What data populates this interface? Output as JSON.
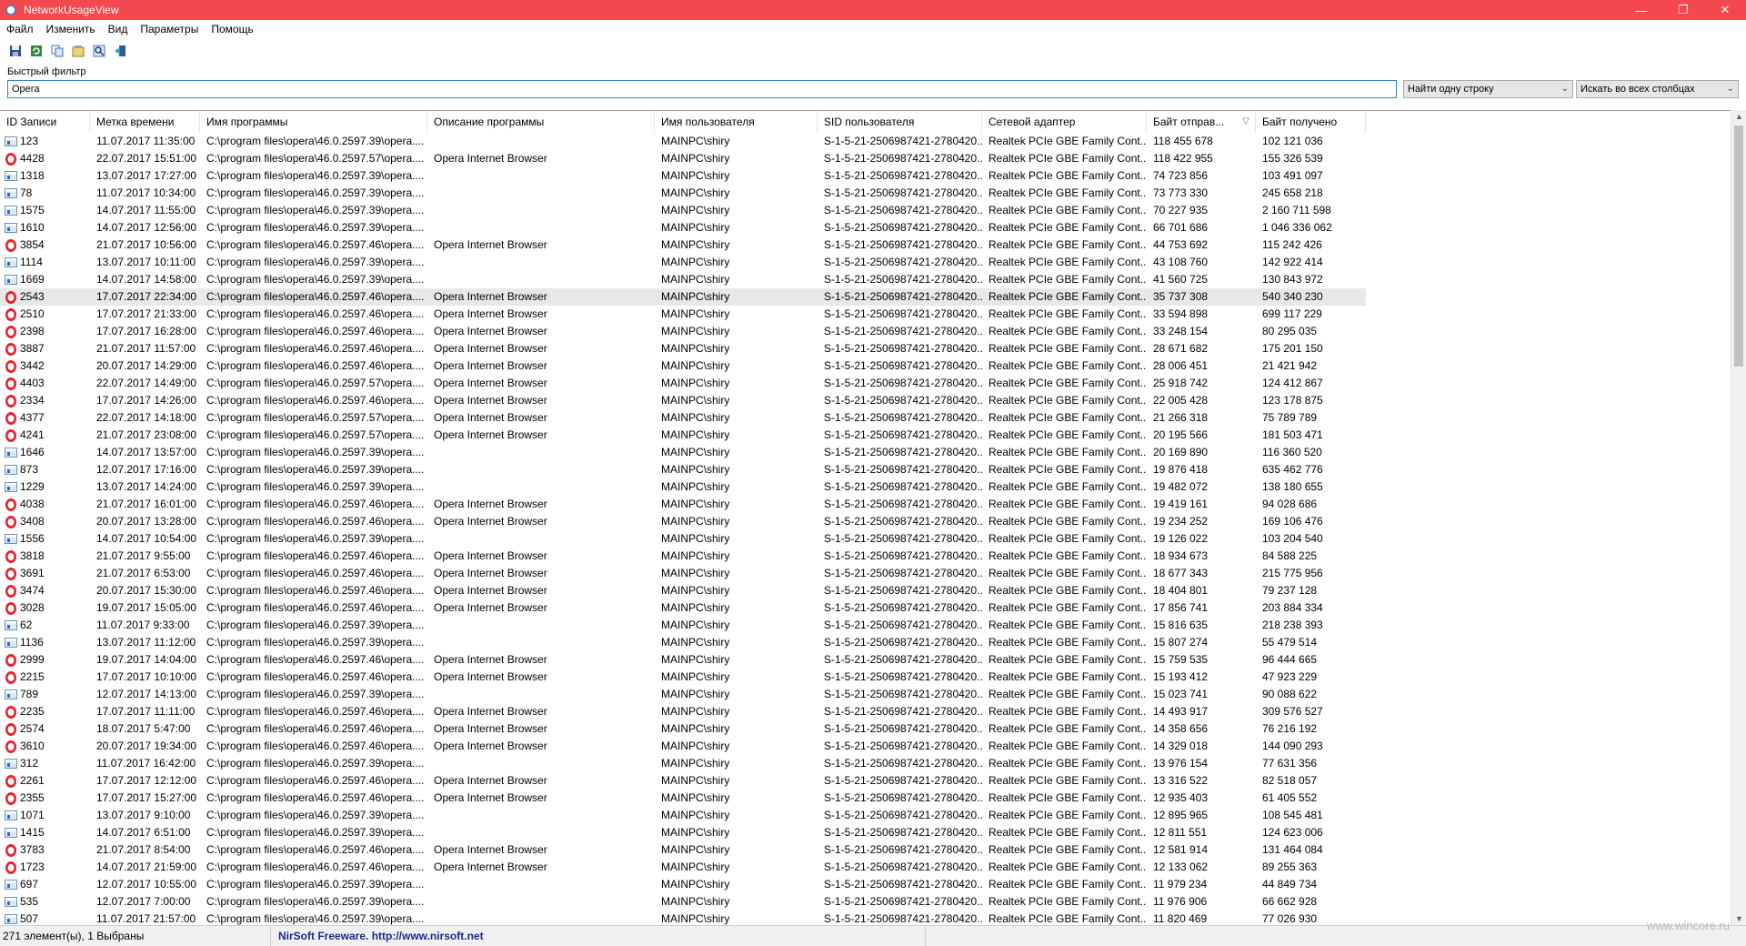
{
  "window": {
    "title": "NetworkUsageView",
    "minimize": "—",
    "maximize": "❐",
    "close": "✕"
  },
  "menu": [
    "Файл",
    "Изменить",
    "Вид",
    "Параметры",
    "Помощь"
  ],
  "toolbar": [
    "save-icon",
    "refresh-icon",
    "copy-icon",
    "properties-icon",
    "find-icon",
    "exit-icon"
  ],
  "filter": {
    "label": "Быстрый фильтр",
    "value": "Opera",
    "mode": "Найти одну строку",
    "scope": "Искать во всех столбцах"
  },
  "columns": [
    "ID Записи",
    "Метка времени",
    "Имя программы",
    "Описание программы",
    "Имя пользователя",
    "SID пользователя",
    "Сетевой адаптер",
    "Байт отправ...",
    "Байт получено"
  ],
  "rows": [
    {
      "icon": "app",
      "id": "123",
      "time": "11.07.2017 11:35:00",
      "prog": "C:\\program files\\opera\\46.0.2597.39\\opera....",
      "desc": "",
      "user": "MAINPC\\shiry",
      "sid": "S-1-5-21-2506987421-2780420...",
      "adapter": "Realtek PCIe GBE Family Cont...",
      "sent": "118 455 678",
      "recv": "102 121 036"
    },
    {
      "icon": "opera",
      "id": "4428",
      "time": "22.07.2017 15:51:00",
      "prog": "C:\\program files\\opera\\46.0.2597.57\\opera....",
      "desc": "Opera Internet Browser",
      "user": "MAINPC\\shiry",
      "sid": "S-1-5-21-2506987421-2780420...",
      "adapter": "Realtek PCIe GBE Family Cont...",
      "sent": "118 422 955",
      "recv": "155 326 539"
    },
    {
      "icon": "app",
      "id": "1318",
      "time": "13.07.2017 17:27:00",
      "prog": "C:\\program files\\opera\\46.0.2597.39\\opera....",
      "desc": "",
      "user": "MAINPC\\shiry",
      "sid": "S-1-5-21-2506987421-2780420...",
      "adapter": "Realtek PCIe GBE Family Cont...",
      "sent": "74 723 856",
      "recv": "103 491 097"
    },
    {
      "icon": "app",
      "id": "78",
      "time": "11.07.2017 10:34:00",
      "prog": "C:\\program files\\opera\\46.0.2597.39\\opera....",
      "desc": "",
      "user": "MAINPC\\shiry",
      "sid": "S-1-5-21-2506987421-2780420...",
      "adapter": "Realtek PCIe GBE Family Cont...",
      "sent": "73 773 330",
      "recv": "245 658 218"
    },
    {
      "icon": "app",
      "id": "1575",
      "time": "14.07.2017 11:55:00",
      "prog": "C:\\program files\\opera\\46.0.2597.39\\opera....",
      "desc": "",
      "user": "MAINPC\\shiry",
      "sid": "S-1-5-21-2506987421-2780420...",
      "adapter": "Realtek PCIe GBE Family Cont...",
      "sent": "70 227 935",
      "recv": "2 160 711 598"
    },
    {
      "icon": "app",
      "id": "1610",
      "time": "14.07.2017 12:56:00",
      "prog": "C:\\program files\\opera\\46.0.2597.39\\opera....",
      "desc": "",
      "user": "MAINPC\\shiry",
      "sid": "S-1-5-21-2506987421-2780420...",
      "adapter": "Realtek PCIe GBE Family Cont...",
      "sent": "66 701 686",
      "recv": "1 046 336 062"
    },
    {
      "icon": "opera",
      "id": "3854",
      "time": "21.07.2017 10:56:00",
      "prog": "C:\\program files\\opera\\46.0.2597.46\\opera....",
      "desc": "Opera Internet Browser",
      "user": "MAINPC\\shiry",
      "sid": "S-1-5-21-2506987421-2780420...",
      "adapter": "Realtek PCIe GBE Family Cont...",
      "sent": "44 753 692",
      "recv": "115 242 426"
    },
    {
      "icon": "app",
      "id": "1114",
      "time": "13.07.2017 10:11:00",
      "prog": "C:\\program files\\opera\\46.0.2597.39\\opera....",
      "desc": "",
      "user": "MAINPC\\shiry",
      "sid": "S-1-5-21-2506987421-2780420...",
      "adapter": "Realtek PCIe GBE Family Cont...",
      "sent": "43 108 760",
      "recv": "142 922 414"
    },
    {
      "icon": "app",
      "id": "1669",
      "time": "14.07.2017 14:58:00",
      "prog": "C:\\program files\\opera\\46.0.2597.39\\opera....",
      "desc": "",
      "user": "MAINPC\\shiry",
      "sid": "S-1-5-21-2506987421-2780420...",
      "adapter": "Realtek PCIe GBE Family Cont...",
      "sent": "41 560 725",
      "recv": "130 843 972"
    },
    {
      "icon": "opera",
      "id": "2543",
      "time": "17.07.2017 22:34:00",
      "prog": "C:\\program files\\opera\\46.0.2597.46\\opera....",
      "desc": "Opera Internet Browser",
      "user": "MAINPC\\shiry",
      "sid": "S-1-5-21-2506987421-2780420...",
      "adapter": "Realtek PCIe GBE Family Cont...",
      "sent": "35 737 308",
      "recv": "540 340 230",
      "selected": true
    },
    {
      "icon": "opera",
      "id": "2510",
      "time": "17.07.2017 21:33:00",
      "prog": "C:\\program files\\opera\\46.0.2597.46\\opera....",
      "desc": "Opera Internet Browser",
      "user": "MAINPC\\shiry",
      "sid": "S-1-5-21-2506987421-2780420...",
      "adapter": "Realtek PCIe GBE Family Cont...",
      "sent": "33 594 898",
      "recv": "699 117 229"
    },
    {
      "icon": "opera",
      "id": "2398",
      "time": "17.07.2017 16:28:00",
      "prog": "C:\\program files\\opera\\46.0.2597.46\\opera....",
      "desc": "Opera Internet Browser",
      "user": "MAINPC\\shiry",
      "sid": "S-1-5-21-2506987421-2780420...",
      "adapter": "Realtek PCIe GBE Family Cont...",
      "sent": "33 248 154",
      "recv": "80 295 035"
    },
    {
      "icon": "opera",
      "id": "3887",
      "time": "21.07.2017 11:57:00",
      "prog": "C:\\program files\\opera\\46.0.2597.46\\opera....",
      "desc": "Opera Internet Browser",
      "user": "MAINPC\\shiry",
      "sid": "S-1-5-21-2506987421-2780420...",
      "adapter": "Realtek PCIe GBE Family Cont...",
      "sent": "28 671 682",
      "recv": "175 201 150"
    },
    {
      "icon": "opera",
      "id": "3442",
      "time": "20.07.2017 14:29:00",
      "prog": "C:\\program files\\opera\\46.0.2597.46\\opera....",
      "desc": "Opera Internet Browser",
      "user": "MAINPC\\shiry",
      "sid": "S-1-5-21-2506987421-2780420...",
      "adapter": "Realtek PCIe GBE Family Cont...",
      "sent": "28 006 451",
      "recv": "21 421 942"
    },
    {
      "icon": "opera",
      "id": "4403",
      "time": "22.07.2017 14:49:00",
      "prog": "C:\\program files\\opera\\46.0.2597.57\\opera....",
      "desc": "Opera Internet Browser",
      "user": "MAINPC\\shiry",
      "sid": "S-1-5-21-2506987421-2780420...",
      "adapter": "Realtek PCIe GBE Family Cont...",
      "sent": "25 918 742",
      "recv": "124 412 867"
    },
    {
      "icon": "opera",
      "id": "2334",
      "time": "17.07.2017 14:26:00",
      "prog": "C:\\program files\\opera\\46.0.2597.46\\opera....",
      "desc": "Opera Internet Browser",
      "user": "MAINPC\\shiry",
      "sid": "S-1-5-21-2506987421-2780420...",
      "adapter": "Realtek PCIe GBE Family Cont...",
      "sent": "22 005 428",
      "recv": "123 178 875"
    },
    {
      "icon": "opera",
      "id": "4377",
      "time": "22.07.2017 14:18:00",
      "prog": "C:\\program files\\opera\\46.0.2597.57\\opera....",
      "desc": "Opera Internet Browser",
      "user": "MAINPC\\shiry",
      "sid": "S-1-5-21-2506987421-2780420...",
      "adapter": "Realtek PCIe GBE Family Cont...",
      "sent": "21 266 318",
      "recv": "75 789 789"
    },
    {
      "icon": "opera",
      "id": "4241",
      "time": "21.07.2017 23:08:00",
      "prog": "C:\\program files\\opera\\46.0.2597.57\\opera....",
      "desc": "Opera Internet Browser",
      "user": "MAINPC\\shiry",
      "sid": "S-1-5-21-2506987421-2780420...",
      "adapter": "Realtek PCIe GBE Family Cont...",
      "sent": "20 195 566",
      "recv": "181 503 471"
    },
    {
      "icon": "app",
      "id": "1646",
      "time": "14.07.2017 13:57:00",
      "prog": "C:\\program files\\opera\\46.0.2597.39\\opera....",
      "desc": "",
      "user": "MAINPC\\shiry",
      "sid": "S-1-5-21-2506987421-2780420...",
      "adapter": "Realtek PCIe GBE Family Cont...",
      "sent": "20 169 890",
      "recv": "116 360 520"
    },
    {
      "icon": "app",
      "id": "873",
      "time": "12.07.2017 17:16:00",
      "prog": "C:\\program files\\opera\\46.0.2597.39\\opera....",
      "desc": "",
      "user": "MAINPC\\shiry",
      "sid": "S-1-5-21-2506987421-2780420...",
      "adapter": "Realtek PCIe GBE Family Cont...",
      "sent": "19 876 418",
      "recv": "635 462 776"
    },
    {
      "icon": "app",
      "id": "1229",
      "time": "13.07.2017 14:24:00",
      "prog": "C:\\program files\\opera\\46.0.2597.39\\opera....",
      "desc": "",
      "user": "MAINPC\\shiry",
      "sid": "S-1-5-21-2506987421-2780420...",
      "adapter": "Realtek PCIe GBE Family Cont...",
      "sent": "19 482 072",
      "recv": "138 180 655"
    },
    {
      "icon": "opera",
      "id": "4038",
      "time": "21.07.2017 16:01:00",
      "prog": "C:\\program files\\opera\\46.0.2597.46\\opera....",
      "desc": "Opera Internet Browser",
      "user": "MAINPC\\shiry",
      "sid": "S-1-5-21-2506987421-2780420...",
      "adapter": "Realtek PCIe GBE Family Cont...",
      "sent": "19 419 161",
      "recv": "94 028 686"
    },
    {
      "icon": "opera",
      "id": "3408",
      "time": "20.07.2017 13:28:00",
      "prog": "C:\\program files\\opera\\46.0.2597.46\\opera....",
      "desc": "Opera Internet Browser",
      "user": "MAINPC\\shiry",
      "sid": "S-1-5-21-2506987421-2780420...",
      "adapter": "Realtek PCIe GBE Family Cont...",
      "sent": "19 234 252",
      "recv": "169 106 476"
    },
    {
      "icon": "app",
      "id": "1556",
      "time": "14.07.2017 10:54:00",
      "prog": "C:\\program files\\opera\\46.0.2597.39\\opera....",
      "desc": "",
      "user": "MAINPC\\shiry",
      "sid": "S-1-5-21-2506987421-2780420...",
      "adapter": "Realtek PCIe GBE Family Cont...",
      "sent": "19 126 022",
      "recv": "103 204 540"
    },
    {
      "icon": "opera",
      "id": "3818",
      "time": "21.07.2017 9:55:00",
      "prog": "C:\\program files\\opera\\46.0.2597.46\\opera....",
      "desc": "Opera Internet Browser",
      "user": "MAINPC\\shiry",
      "sid": "S-1-5-21-2506987421-2780420...",
      "adapter": "Realtek PCIe GBE Family Cont...",
      "sent": "18 934 673",
      "recv": "84 588 225"
    },
    {
      "icon": "opera",
      "id": "3691",
      "time": "21.07.2017 6:53:00",
      "prog": "C:\\program files\\opera\\46.0.2597.46\\opera....",
      "desc": "Opera Internet Browser",
      "user": "MAINPC\\shiry",
      "sid": "S-1-5-21-2506987421-2780420...",
      "adapter": "Realtek PCIe GBE Family Cont...",
      "sent": "18 677 343",
      "recv": "215 775 956"
    },
    {
      "icon": "opera",
      "id": "3474",
      "time": "20.07.2017 15:30:00",
      "prog": "C:\\program files\\opera\\46.0.2597.46\\opera....",
      "desc": "Opera Internet Browser",
      "user": "MAINPC\\shiry",
      "sid": "S-1-5-21-2506987421-2780420...",
      "adapter": "Realtek PCIe GBE Family Cont...",
      "sent": "18 404 801",
      "recv": "79 237 128"
    },
    {
      "icon": "opera",
      "id": "3028",
      "time": "19.07.2017 15:05:00",
      "prog": "C:\\program files\\opera\\46.0.2597.46\\opera....",
      "desc": "Opera Internet Browser",
      "user": "MAINPC\\shiry",
      "sid": "S-1-5-21-2506987421-2780420...",
      "adapter": "Realtek PCIe GBE Family Cont...",
      "sent": "17 856 741",
      "recv": "203 884 334"
    },
    {
      "icon": "app",
      "id": "62",
      "time": "11.07.2017 9:33:00",
      "prog": "C:\\program files\\opera\\46.0.2597.39\\opera....",
      "desc": "",
      "user": "MAINPC\\shiry",
      "sid": "S-1-5-21-2506987421-2780420...",
      "adapter": "Realtek PCIe GBE Family Cont...",
      "sent": "15 816 635",
      "recv": "218 238 393"
    },
    {
      "icon": "app",
      "id": "1136",
      "time": "13.07.2017 11:12:00",
      "prog": "C:\\program files\\opera\\46.0.2597.39\\opera....",
      "desc": "",
      "user": "MAINPC\\shiry",
      "sid": "S-1-5-21-2506987421-2780420...",
      "adapter": "Realtek PCIe GBE Family Cont...",
      "sent": "15 807 274",
      "recv": "55 479 514"
    },
    {
      "icon": "opera",
      "id": "2999",
      "time": "19.07.2017 14:04:00",
      "prog": "C:\\program files\\opera\\46.0.2597.46\\opera....",
      "desc": "Opera Internet Browser",
      "user": "MAINPC\\shiry",
      "sid": "S-1-5-21-2506987421-2780420...",
      "adapter": "Realtek PCIe GBE Family Cont...",
      "sent": "15 759 535",
      "recv": "96 444 665"
    },
    {
      "icon": "opera",
      "id": "2215",
      "time": "17.07.2017 10:10:00",
      "prog": "C:\\program files\\opera\\46.0.2597.46\\opera....",
      "desc": "Opera Internet Browser",
      "user": "MAINPC\\shiry",
      "sid": "S-1-5-21-2506987421-2780420...",
      "adapter": "Realtek PCIe GBE Family Cont...",
      "sent": "15 193 412",
      "recv": "47 923 229"
    },
    {
      "icon": "app",
      "id": "789",
      "time": "12.07.2017 14:13:00",
      "prog": "C:\\program files\\opera\\46.0.2597.39\\opera....",
      "desc": "",
      "user": "MAINPC\\shiry",
      "sid": "S-1-5-21-2506987421-2780420...",
      "adapter": "Realtek PCIe GBE Family Cont...",
      "sent": "15 023 741",
      "recv": "90 088 622"
    },
    {
      "icon": "opera",
      "id": "2235",
      "time": "17.07.2017 11:11:00",
      "prog": "C:\\program files\\opera\\46.0.2597.46\\opera....",
      "desc": "Opera Internet Browser",
      "user": "MAINPC\\shiry",
      "sid": "S-1-5-21-2506987421-2780420...",
      "adapter": "Realtek PCIe GBE Family Cont...",
      "sent": "14 493 917",
      "recv": "309 576 527"
    },
    {
      "icon": "opera",
      "id": "2574",
      "time": "18.07.2017 5:47:00",
      "prog": "C:\\program files\\opera\\46.0.2597.46\\opera....",
      "desc": "Opera Internet Browser",
      "user": "MAINPC\\shiry",
      "sid": "S-1-5-21-2506987421-2780420...",
      "adapter": "Realtek PCIe GBE Family Cont...",
      "sent": "14 358 656",
      "recv": "76 216 192"
    },
    {
      "icon": "opera",
      "id": "3610",
      "time": "20.07.2017 19:34:00",
      "prog": "C:\\program files\\opera\\46.0.2597.46\\opera....",
      "desc": "Opera Internet Browser",
      "user": "MAINPC\\shiry",
      "sid": "S-1-5-21-2506987421-2780420...",
      "adapter": "Realtek PCIe GBE Family Cont...",
      "sent": "14 329 018",
      "recv": "144 090 293"
    },
    {
      "icon": "app",
      "id": "312",
      "time": "11.07.2017 16:42:00",
      "prog": "C:\\program files\\opera\\46.0.2597.39\\opera....",
      "desc": "",
      "user": "MAINPC\\shiry",
      "sid": "S-1-5-21-2506987421-2780420...",
      "adapter": "Realtek PCIe GBE Family Cont...",
      "sent": "13 976 154",
      "recv": "77 631 356"
    },
    {
      "icon": "opera",
      "id": "2261",
      "time": "17.07.2017 12:12:00",
      "prog": "C:\\program files\\opera\\46.0.2597.46\\opera....",
      "desc": "Opera Internet Browser",
      "user": "MAINPC\\shiry",
      "sid": "S-1-5-21-2506987421-2780420...",
      "adapter": "Realtek PCIe GBE Family Cont...",
      "sent": "13 316 522",
      "recv": "82 518 057"
    },
    {
      "icon": "opera",
      "id": "2355",
      "time": "17.07.2017 15:27:00",
      "prog": "C:\\program files\\opera\\46.0.2597.46\\opera....",
      "desc": "Opera Internet Browser",
      "user": "MAINPC\\shiry",
      "sid": "S-1-5-21-2506987421-2780420...",
      "adapter": "Realtek PCIe GBE Family Cont...",
      "sent": "12 935 403",
      "recv": "61 405 552"
    },
    {
      "icon": "app",
      "id": "1071",
      "time": "13.07.2017 9:10:00",
      "prog": "C:\\program files\\opera\\46.0.2597.39\\opera....",
      "desc": "",
      "user": "MAINPC\\shiry",
      "sid": "S-1-5-21-2506987421-2780420...",
      "adapter": "Realtek PCIe GBE Family Cont...",
      "sent": "12 895 965",
      "recv": "108 545 481"
    },
    {
      "icon": "app",
      "id": "1415",
      "time": "14.07.2017 6:51:00",
      "prog": "C:\\program files\\opera\\46.0.2597.39\\opera....",
      "desc": "",
      "user": "MAINPC\\shiry",
      "sid": "S-1-5-21-2506987421-2780420...",
      "adapter": "Realtek PCIe GBE Family Cont...",
      "sent": "12 811 551",
      "recv": "124 623 006"
    },
    {
      "icon": "opera",
      "id": "3783",
      "time": "21.07.2017 8:54:00",
      "prog": "C:\\program files\\opera\\46.0.2597.46\\opera....",
      "desc": "Opera Internet Browser",
      "user": "MAINPC\\shiry",
      "sid": "S-1-5-21-2506987421-2780420...",
      "adapter": "Realtek PCIe GBE Family Cont...",
      "sent": "12 581 914",
      "recv": "131 464 084"
    },
    {
      "icon": "opera",
      "id": "1723",
      "time": "14.07.2017 21:59:00",
      "prog": "C:\\program files\\opera\\46.0.2597.46\\opera....",
      "desc": "Opera Internet Browser",
      "user": "MAINPC\\shiry",
      "sid": "S-1-5-21-2506987421-2780420...",
      "adapter": "Realtek PCIe GBE Family Cont...",
      "sent": "12 133 062",
      "recv": "89 255 363"
    },
    {
      "icon": "app",
      "id": "697",
      "time": "12.07.2017 10:55:00",
      "prog": "C:\\program files\\opera\\46.0.2597.39\\opera....",
      "desc": "",
      "user": "MAINPC\\shiry",
      "sid": "S-1-5-21-2506987421-2780420...",
      "adapter": "Realtek PCIe GBE Family Cont...",
      "sent": "11 979 234",
      "recv": "44 849 734"
    },
    {
      "icon": "app",
      "id": "535",
      "time": "12.07.2017 7:00:00",
      "prog": "C:\\program files\\opera\\46.0.2597.39\\opera....",
      "desc": "",
      "user": "MAINPC\\shiry",
      "sid": "S-1-5-21-2506987421-2780420...",
      "adapter": "Realtek PCIe GBE Family Cont...",
      "sent": "11 976 906",
      "recv": "66 662 928"
    },
    {
      "icon": "app",
      "id": "507",
      "time": "11.07.2017 21:57:00",
      "prog": "C:\\program files\\opera\\46.0.2597.39\\opera....",
      "desc": "",
      "user": "MAINPC\\shiry",
      "sid": "S-1-5-21-2506987421-2780420...",
      "adapter": "Realtek PCIe GBE Family Cont...",
      "sent": "11 820 469",
      "recv": "77 026 930"
    }
  ],
  "status": {
    "count": "271 элемент(ы), 1 Выбраны",
    "credit": "NirSoft Freeware.  http://www.nirsoft.net"
  },
  "watermark": "www.wincore.ru"
}
